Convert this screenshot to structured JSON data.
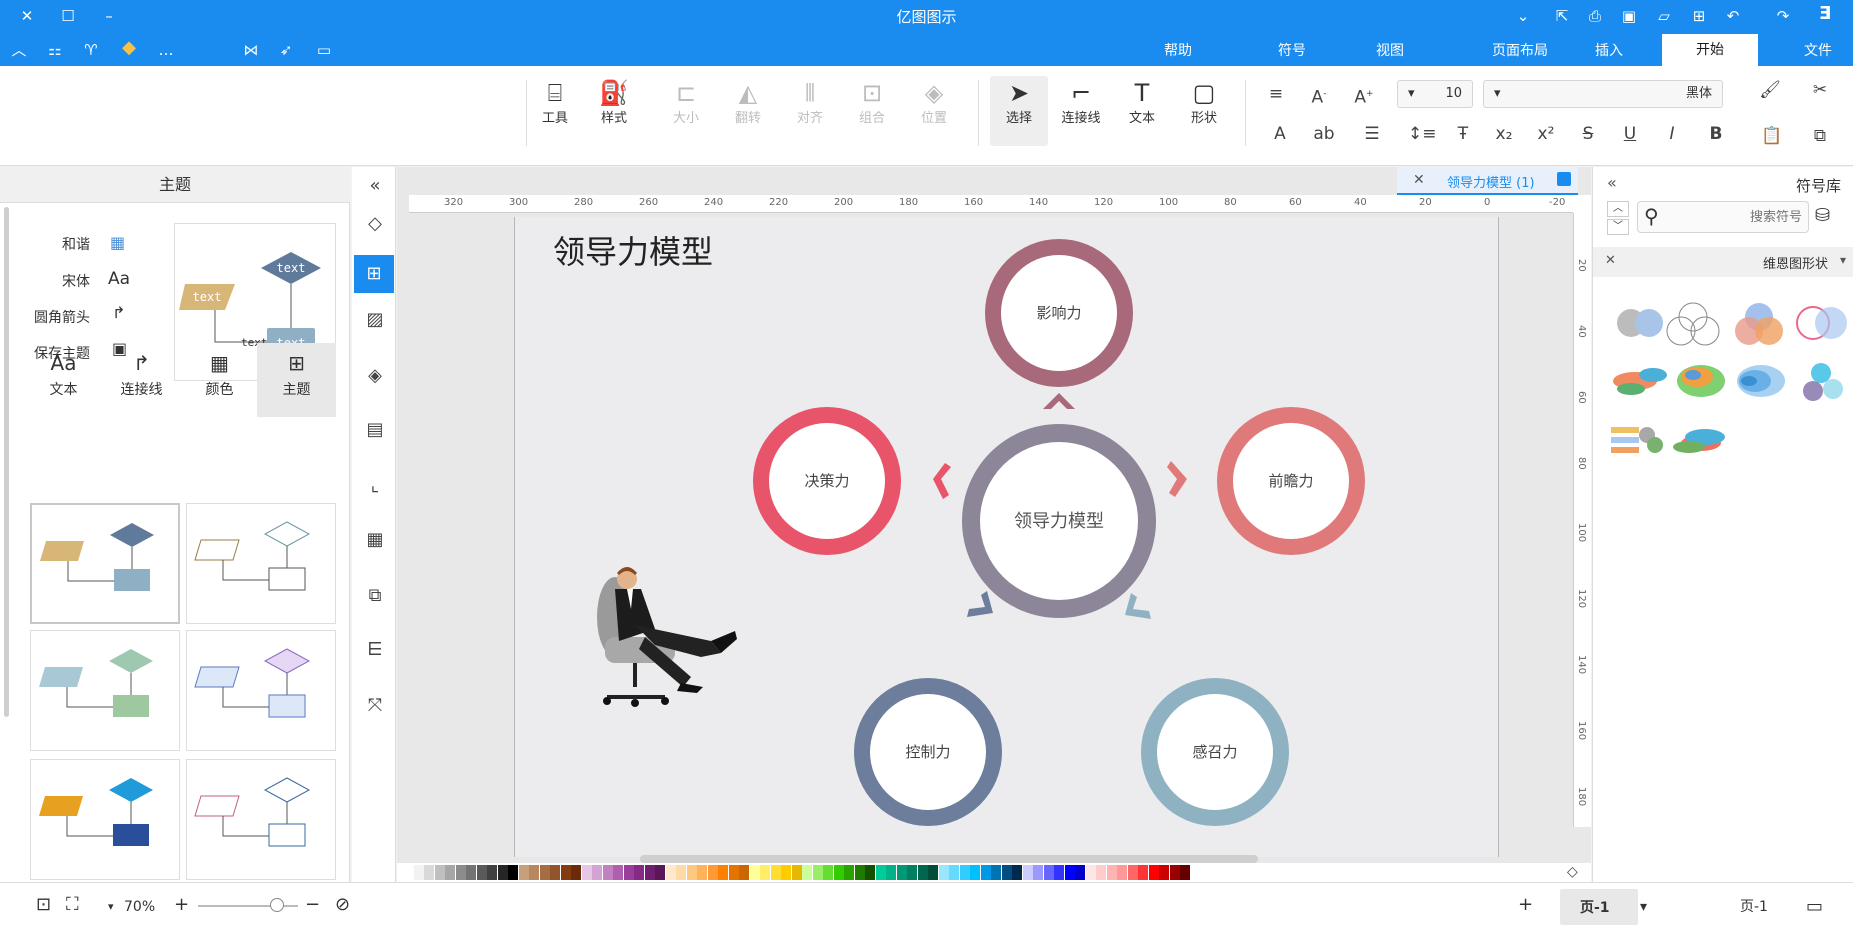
{
  "app": {
    "title": "亿图图示"
  },
  "titlebar_icons": [
    "logo-icon",
    "redo-icon",
    "undo-icon",
    "new-icon",
    "open-icon",
    "save-icon",
    "print-icon",
    "export-icon",
    "more-icon",
    "apps-icon",
    "shirt-icon",
    "vip-icon",
    "share-icon",
    "publish-icon",
    "comment-icon",
    "minimize-icon",
    "maximize-icon",
    "close-icon",
    "collapse-icon"
  ],
  "menu": {
    "tabs": [
      "文件",
      "开始",
      "插入",
      "页面布局",
      "视图",
      "符号",
      "帮助"
    ],
    "active": "开始"
  },
  "ribbon": {
    "font_name": "黑体",
    "font_size": "10",
    "buttons": {
      "shape": "形状",
      "text": "文本",
      "connector": "连接线",
      "select": "选择",
      "position": "位置",
      "group": "组合",
      "align": "对齐",
      "rotate": "翻转",
      "size": "大小",
      "style": "样式",
      "tools": "工具"
    }
  },
  "left_panel": {
    "title": "主题",
    "options": [
      "和谐",
      "宋体",
      "圆角箭头",
      "保存主题"
    ],
    "tabs": [
      "主题",
      "颜色",
      "连接线",
      "文本"
    ],
    "preview_text": [
      "text",
      "text",
      "text"
    ]
  },
  "canvas": {
    "doc_tab": "领导力模型 (1)",
    "ruler_h": [
      "-20",
      "0",
      "20",
      "40",
      "60",
      "80",
      "100",
      "120",
      "140",
      "160",
      "180",
      "200",
      "220",
      "240",
      "260",
      "280",
      "300",
      "320"
    ],
    "ruler_v": [
      "20",
      "40",
      "60",
      "80",
      "100",
      "120",
      "140",
      "160",
      "180"
    ],
    "diagram_title": "领导力模型",
    "center_label": "领导力模型",
    "nodes": [
      {
        "label": "影响力",
        "color": "#a86a7a"
      },
      {
        "label": "前瞻力",
        "color": "#e07a7a"
      },
      {
        "label": "感召力",
        "color": "#8fb2c2"
      },
      {
        "label": "控制力",
        "color": "#6c7e9c"
      },
      {
        "label": "决策力",
        "color": "#e8546a"
      }
    ],
    "center_color": "#8c8698"
  },
  "right_panel": {
    "title": "符号库",
    "search_placeholder": "搜索符号",
    "library": "维恩图形状"
  },
  "status": {
    "page_tab": "页-1",
    "page_tab2": "页-1",
    "zoom": "70%"
  },
  "palette": [
    "#ffffff",
    "#f2f2f2",
    "#d9d9d9",
    "#bfbfbf",
    "#a6a6a6",
    "#8c8c8c",
    "#737373",
    "#595959",
    "#404040",
    "#262626",
    "#000000",
    "#c7a07a",
    "#b88760",
    "#a66d45",
    "#94542b",
    "#833b10",
    "#6b2a0a",
    "#e7c6e7",
    "#d4a3d4",
    "#c181c1",
    "#ae5fae",
    "#9b3d9b",
    "#862a86",
    "#6f1f6f",
    "#59175a",
    "#ffe8cc",
    "#ffd9a6",
    "#ffc880",
    "#ffb259",
    "#ff9933",
    "#ff8000",
    "#e67300",
    "#cc6600",
    "#ffff99",
    "#ffee66",
    "#ffdd33",
    "#ffcc00",
    "#e6b800",
    "#ccff99",
    "#99ee66",
    "#66dd33",
    "#33cc00",
    "#29a300",
    "#1f7a00",
    "#145200",
    "#00cc99",
    "#00b386",
    "#009973",
    "#008060",
    "#00664d",
    "#004d39",
    "#99e6ff",
    "#66d9ff",
    "#33ccff",
    "#00bfff",
    "#0099e6",
    "#0073b3",
    "#004d80",
    "#002a4d",
    "#ccccff",
    "#9999ff",
    "#6666ff",
    "#3333ff",
    "#0000ff",
    "#0000cc",
    "#ffe6e6",
    "#ffcccc",
    "#ffb3b3",
    "#ff9999",
    "#ff6666",
    "#ff3333",
    "#ff0000",
    "#cc0000",
    "#990000",
    "#660000"
  ]
}
